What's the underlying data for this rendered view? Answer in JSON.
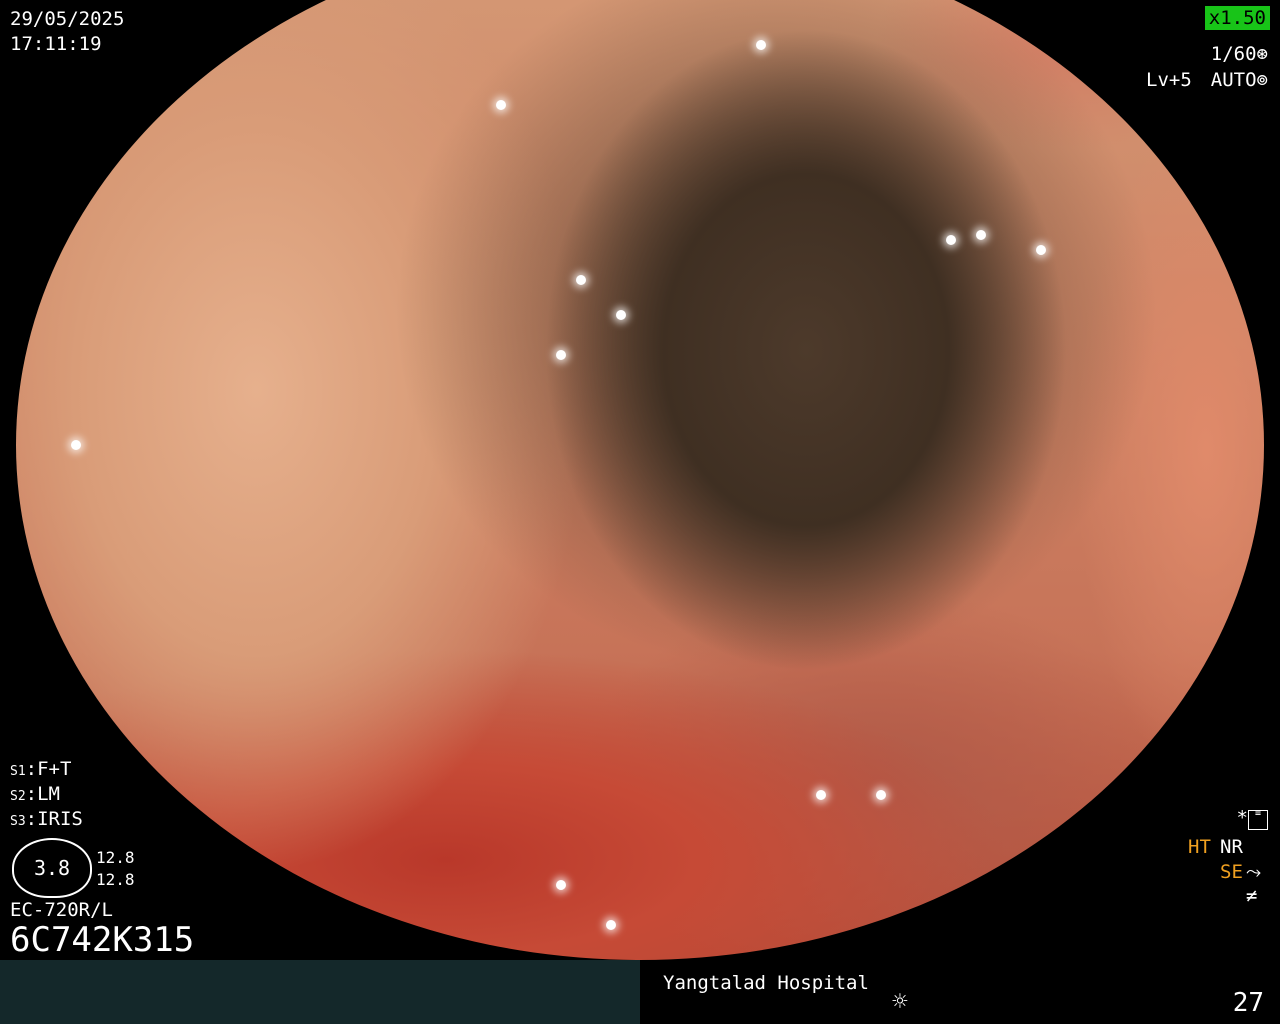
{
  "header": {
    "date": "29/05/2025",
    "time": "17:11:19",
    "zoom": "x1.50",
    "shutter": "1/60",
    "level": "Lv+5",
    "mode": "AUTO"
  },
  "switches": {
    "s1_label": "S1",
    "s1_value": "F+T",
    "s2_label": "S2",
    "s2_value": "LM",
    "s3_label": "S3",
    "s3_value": "IRIS"
  },
  "gauge": {
    "value": "3.8",
    "reading_a": "12.8",
    "reading_b": "12.8"
  },
  "scope": {
    "model": "EC-720R/L",
    "serial": "6C742K315"
  },
  "enhancements": {
    "star": "*",
    "ht": "HT",
    "nr": "NR",
    "se": "SE",
    "neq": "≠"
  },
  "footer": {
    "hospital": "Yangtalad Hospital",
    "counter": "27"
  },
  "colors": {
    "zoom_badge": "#18c418",
    "highlight": "#f0a020",
    "footer_left": "#14282a"
  }
}
